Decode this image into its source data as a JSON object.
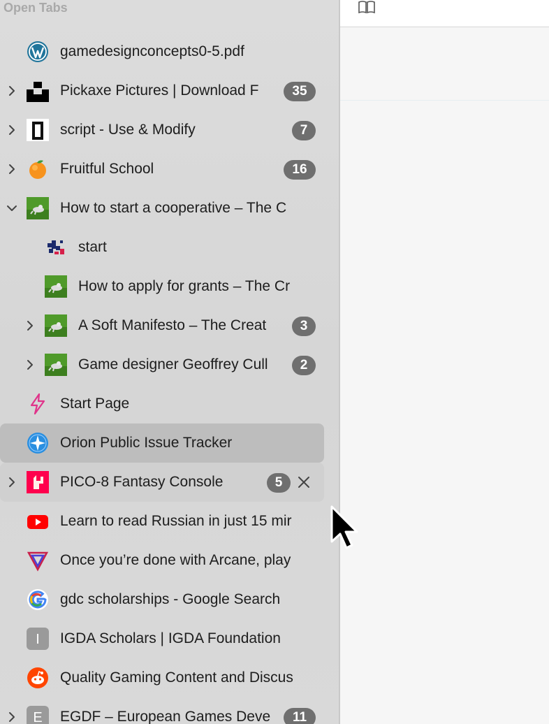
{
  "sidebar": {
    "title": "Open Tabs",
    "tabs": [
      {
        "title": "gamedesignconcepts0-5.pdf",
        "badge": "",
        "icon": "wordpress-icon",
        "chevron": "none",
        "level": 0
      },
      {
        "title": "Pickaxe Pictures | Download F",
        "badge": "35",
        "icon": "unsplash-icon",
        "chevron": "right",
        "level": 0
      },
      {
        "title": "script - Use & Modify",
        "badge": "7",
        "icon": "script-icon",
        "chevron": "right",
        "level": 0
      },
      {
        "title": "Fruitful School",
        "badge": "16",
        "icon": "orange-icon",
        "chevron": "right",
        "level": 0
      },
      {
        "title": "How to start a cooperative – The C",
        "badge": "",
        "icon": "frog-icon",
        "chevron": "down",
        "level": 0
      },
      {
        "title": "start",
        "badge": "",
        "icon": "pixel-art-icon",
        "chevron": "none",
        "level": 1
      },
      {
        "title": "How to apply for grants – The Cr",
        "badge": "",
        "icon": "frog-icon",
        "chevron": "none",
        "level": 1
      },
      {
        "title": "A Soft Manifesto – The Creat",
        "badge": "3",
        "icon": "frog-icon",
        "chevron": "right",
        "level": 1
      },
      {
        "title": "Game designer Geoffrey Cull",
        "badge": "2",
        "icon": "frog-icon",
        "chevron": "right",
        "level": 1
      },
      {
        "title": "Start Page",
        "badge": "",
        "icon": "lightning-icon",
        "chevron": "none",
        "level": 0
      },
      {
        "title": "Orion Public Issue Tracker",
        "badge": "",
        "icon": "compass-icon",
        "chevron": "none",
        "level": 0,
        "state": "selected"
      },
      {
        "title": "PICO-8 Fantasy Console",
        "badge": "5",
        "icon": "pico8-icon",
        "chevron": "right",
        "level": 0,
        "state": "hover"
      },
      {
        "title": "Learn to read Russian in just 15 mir",
        "badge": "",
        "icon": "youtube-icon",
        "chevron": "none",
        "level": 0
      },
      {
        "title": "Once you’re done with Arcane, play",
        "badge": "",
        "icon": "triangle-logo-icon",
        "chevron": "none",
        "level": 0
      },
      {
        "title": "gdc scholarships - Google Search",
        "badge": "",
        "icon": "google-icon",
        "chevron": "none",
        "level": 0
      },
      {
        "title": "IGDA Scholars | IGDA Foundation",
        "badge": "",
        "icon": "letter-i-icon",
        "chevron": "none",
        "level": 0,
        "letter": "I"
      },
      {
        "title": "Quality Gaming Content and Discus",
        "badge": "",
        "icon": "reddit-icon",
        "chevron": "none",
        "level": 0
      },
      {
        "title": "EGDF – European Games Deve",
        "badge": "11",
        "icon": "letter-e-icon",
        "chevron": "right",
        "level": 0,
        "letter": "E"
      }
    ]
  },
  "toolbar": {
    "icon": "book-icon"
  }
}
